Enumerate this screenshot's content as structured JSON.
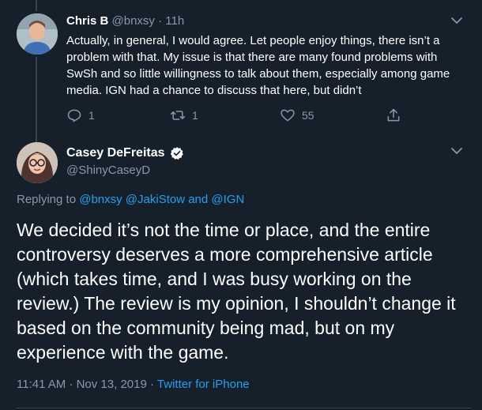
{
  "tweet1": {
    "name": "Chris B",
    "handle": "@bnxsy",
    "time": "11h",
    "body": "Actually, in general, I would agree. Let people enjoy things, there isn’t a problem with that. My issue is that there are many found problems with SwSh and so little willingness to talk about them, especially among game media. IGN had a chance to discuss that here, but didn’t",
    "replies": "1",
    "retweets": "1",
    "likes": "55"
  },
  "tweet2": {
    "name": "Casey DeFreitas",
    "handle": "@ShinyCaseyD",
    "replying_prefix": "Replying to",
    "replying_users": "@bnxsy @JakiStow",
    "replying_and": "and",
    "replying_last": "@IGN",
    "body": "We decided it’s not the time or place, and the entire controversy deserves a more comprehensive article (which takes time, and I was busy working on the review.) The review is my opinion, I shouldn’t change it based on the community being mad, but on my experience with the game.",
    "timestamp": "11:41 AM · Nov 13, 2019 ·",
    "source": "Twitter for iPhone"
  },
  "icons": {
    "reply": "reply-icon",
    "retweet": "retweet-icon",
    "like": "heart-icon",
    "share": "share-icon",
    "more": "chevron-down-icon",
    "verified": "verified-badge-icon"
  },
  "colors": {
    "background": "#15202b",
    "text": "#ffffff",
    "muted": "#8899a6",
    "link": "#1da1f2",
    "divider": "#38444d"
  }
}
